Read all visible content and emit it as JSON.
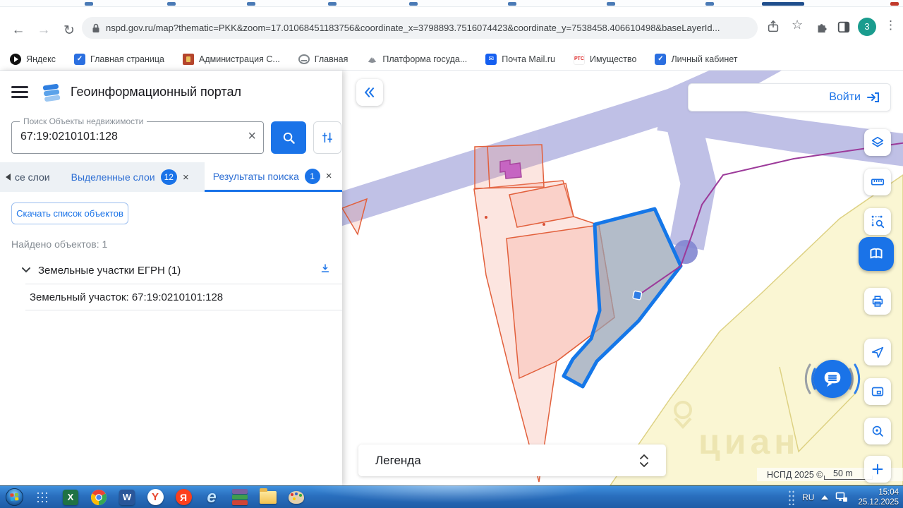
{
  "browser": {
    "url": "nspd.gov.ru/map?thematic=PKK&zoom=17.01068451183756&coordinate_x=3798893.7516074423&coordinate_y=7538458.406610498&baseLayerId...",
    "profile_badge": "3",
    "glyphs": {
      "back": "←",
      "forward": "→",
      "reload": "↻",
      "star": "☆",
      "menu": "⋮",
      "close": "×"
    },
    "bookmarks": [
      {
        "icon": "yandex-start-icon",
        "label": "Яндекс"
      },
      {
        "icon": "gosuslugi-shield-icon",
        "label": "Главная страница",
        "icon_text": "✓"
      },
      {
        "icon": "coat-of-arms-icon",
        "label": "Администрация С..."
      },
      {
        "icon": "globe-icon",
        "label": "Главная"
      },
      {
        "icon": "eagle-emblem-icon",
        "label": "Платформа госуда..."
      },
      {
        "icon": "mailru-envelope-icon",
        "label": "Почта Mail.ru",
        "icon_text": "✉"
      },
      {
        "icon": "rts-icon",
        "label": "Имущество",
        "icon_text": "РТС"
      },
      {
        "icon": "cabinet-shield-icon",
        "label": "Личный кабинет",
        "icon_text": "✓"
      }
    ]
  },
  "portal": {
    "title": "Геоинформационный портал",
    "search": {
      "label": "Поиск Объекты недвижимости",
      "value": "67:19:0210101:128"
    },
    "tabs": {
      "all_layers_label": "се слои",
      "selected_layers_label": "Выделенные слои",
      "selected_layers_count": "12",
      "search_results_label": "Результаты поиска",
      "search_results_count": "1"
    },
    "download_button": "Скачать список объектов",
    "found_text": "Найдено объектов: 1",
    "group_title": "Земельные участки ЕГРН (1)",
    "result_item": "Земельный участок: 67:19:0210101:128"
  },
  "map": {
    "login_label": "Войти",
    "legend_label": "Легенда",
    "attribution": "НСПД 2025 ©",
    "scale_label": "50 m",
    "watermark": "циан",
    "tools": [
      "layers",
      "ruler",
      "search-area",
      "map-book-active",
      "print",
      "locate",
      "overview-map",
      "search-location",
      "zoom-in",
      "chat"
    ]
  },
  "taskbar": {
    "language": "RU",
    "time": "15:04",
    "date": "25.12.2025",
    "app_icons": [
      "start",
      "task-list",
      "excel",
      "chrome",
      "word",
      "yandex-browser",
      "yandex",
      "internet-explorer",
      "winrar",
      "explorer",
      "paint"
    ],
    "glyphs": {
      "excel": "X",
      "word": "W",
      "yandex_browser": "Y",
      "yandex": "Я",
      "ie": "e"
    }
  },
  "colors": {
    "accent": "#1a73e8",
    "selected_parcel_stroke": "#1577e8",
    "parcel_pink_stroke": "#e2603c",
    "road_lavender": "#b5b6e2",
    "zone_yellow": "#faf6d3",
    "magenta_line": "#9c3a9a"
  }
}
